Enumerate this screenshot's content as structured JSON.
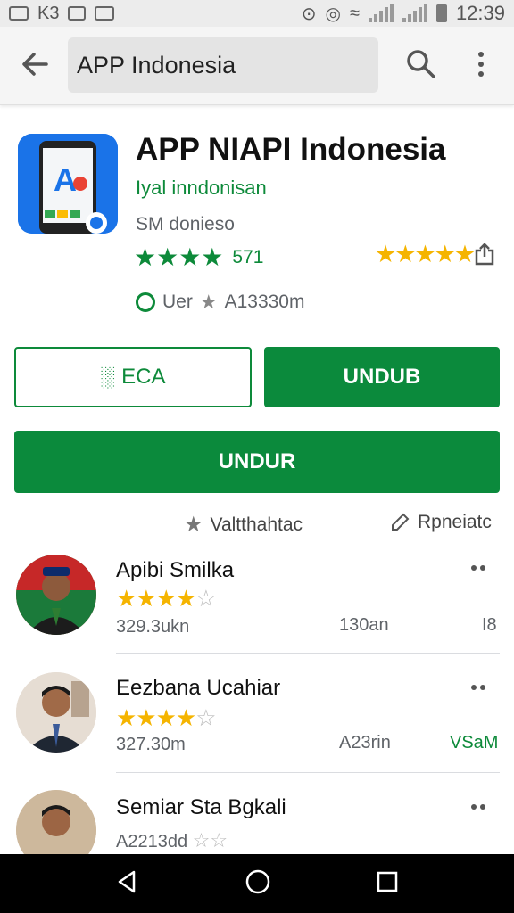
{
  "status_bar": {
    "left_text": "K3",
    "time": "12:39"
  },
  "toolbar": {
    "search_value": "APP Indonesia"
  },
  "app": {
    "title": "APP NIAPI Indonesia",
    "developer": "Iyal inndonisan",
    "subtitle": "SM donieso",
    "rating_count": "571",
    "info_text": "Uer",
    "info_value": "A13330m"
  },
  "buttons": {
    "outline_label": "ECA",
    "solid_label": "UNDUB",
    "wide_label": "UNDUR"
  },
  "links": {
    "left_label": "Valtthahtac",
    "right_label": "Rpneiatc"
  },
  "list": [
    {
      "name": "Apibi Smilka",
      "stars_filled": 4,
      "meta": "329.3ukn",
      "mid": "130an",
      "right": "I8",
      "right_color": "#5f6368"
    },
    {
      "name": "Eezbana Ucahiar",
      "stars_filled": 4,
      "meta": "327.30m",
      "mid": "A23rin",
      "right": "VSaM",
      "right_color": "#0d8a3a"
    },
    {
      "name": "Semiar Sta Bgkali",
      "stars_filled": 0,
      "meta": "A2213dd",
      "mid": "",
      "right": "",
      "right_color": "#5f6368"
    }
  ],
  "colors": {
    "brand_green": "#0b8a3c",
    "star_gold": "#f5b400",
    "app_icon_blue": "#1a73e8"
  }
}
